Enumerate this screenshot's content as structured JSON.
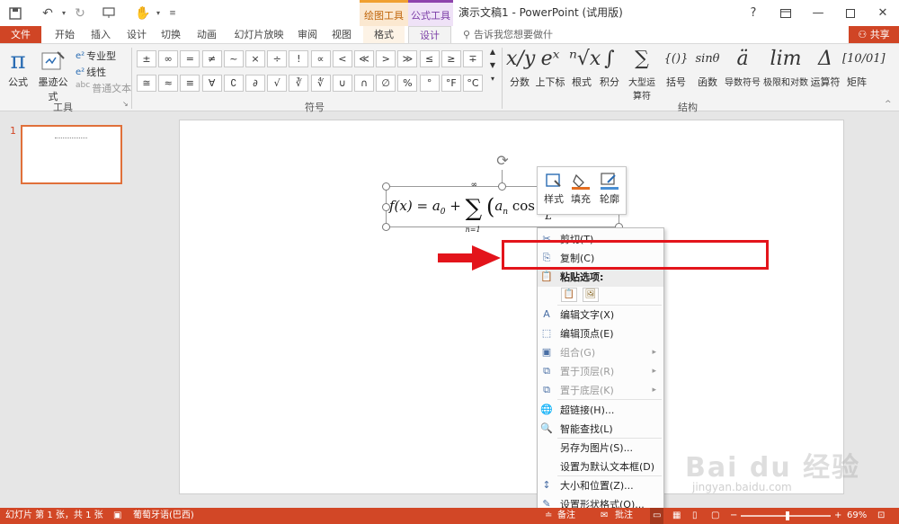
{
  "app": {
    "title": "演示文稿1 - PowerPoint (试用版)",
    "help_icon": "?"
  },
  "context_groups": {
    "drawing_tools": "绘图工具",
    "equation_tools": "公式工具"
  },
  "tabs": {
    "file": "文件",
    "home": "开始",
    "insert": "插入",
    "design": "设计",
    "transitions": "切换",
    "animations": "动画",
    "slideshow": "幻灯片放映",
    "review": "审阅",
    "view": "视图",
    "format": "格式",
    "eq_design": "设计",
    "tell_me": "告诉我您想要做什么...",
    "share": "共享"
  },
  "ribbon": {
    "tools": {
      "equation": "公式",
      "ink_equation": "墨迹公式",
      "professional": "专业型",
      "linear": "线性",
      "normal_text": "普通文本",
      "group_label": "工具"
    },
    "symbols": {
      "row1": [
        "±",
        "∞",
        "=",
        "≠",
        "~",
        "×",
        "÷",
        "!",
        "∝",
        "<",
        "≪",
        ">",
        "≫",
        "≤",
        "≥",
        "∓"
      ],
      "row2": [
        "≅",
        "≈",
        "≡",
        "∀",
        "∁",
        "∂",
        "√",
        "∛",
        "∜",
        "∪",
        "∩",
        "∅",
        "%",
        "°",
        "°F",
        "°C"
      ],
      "group_label": "符号"
    },
    "structures": {
      "items": [
        {
          "glyph": "x/y",
          "label": "分数"
        },
        {
          "glyph": "eˣ",
          "label": "上下标"
        },
        {
          "glyph": "ⁿ√x",
          "label": "根式"
        },
        {
          "glyph": "∫",
          "label": "积分"
        },
        {
          "glyph": "∑",
          "label": "大型运算符"
        },
        {
          "glyph": "{()}",
          "label": "括号"
        },
        {
          "glyph": "sinθ",
          "label": "函数"
        },
        {
          "glyph": "ä",
          "label": "导数符号"
        },
        {
          "glyph": "lim",
          "label": "极限和对数"
        },
        {
          "glyph": "Δ",
          "label": "运算符"
        },
        {
          "glyph": "[10/01]",
          "label": "矩阵"
        }
      ],
      "group_label": "结构"
    }
  },
  "slides_panel": {
    "slide_number": "1"
  },
  "equation": {
    "text": "f(x) = a₀ + ∑ (aₙ cos nπx/L"
  },
  "mini_toolbar": {
    "style": "样式",
    "fill": "填充",
    "outline": "轮廓"
  },
  "context_menu": [
    {
      "label": "剪切(T)",
      "icon": "cut-icon",
      "disabled": false
    },
    {
      "label": "复制(C)",
      "icon": "copy-icon",
      "disabled": false
    },
    {
      "label": "粘贴选项:",
      "icon": "paste-icon",
      "disabled": false
    },
    {
      "label": "编辑文字(X)",
      "icon": "edit-text-icon",
      "disabled": false
    },
    {
      "label": "编辑顶点(E)",
      "icon": "edit-points-icon",
      "disabled": false
    },
    {
      "label": "组合(G)",
      "icon": "group-icon",
      "disabled": true
    },
    {
      "label": "置于顶层(R)",
      "icon": "bring-front-icon",
      "disabled": true
    },
    {
      "label": "置于底层(K)",
      "icon": "send-back-icon",
      "disabled": true
    },
    {
      "label": "超链接(H)...",
      "icon": "hyperlink-icon",
      "disabled": false
    },
    {
      "label": "智能查找(L)",
      "icon": "smart-lookup-icon",
      "disabled": false
    },
    {
      "label": "另存为图片(S)...",
      "icon": "",
      "disabled": false
    },
    {
      "label": "设置为默认文本框(D)",
      "icon": "",
      "disabled": false
    },
    {
      "label": "大小和位置(Z)...",
      "icon": "size-icon",
      "disabled": false
    },
    {
      "label": "设置形状格式(O)...",
      "icon": "format-shape-icon",
      "disabled": false
    }
  ],
  "status": {
    "slide_info": "幻灯片 第 1 张，共 1 张",
    "language": "葡萄牙语(巴西)",
    "notes": "备注",
    "comments": "批注",
    "zoom": "69%"
  },
  "watermark": {
    "main": "Bai du 经验",
    "sub": "jingyan.baidu.com"
  },
  "colors": {
    "accent": "#d24726",
    "annotation_red": "#e3141b"
  }
}
